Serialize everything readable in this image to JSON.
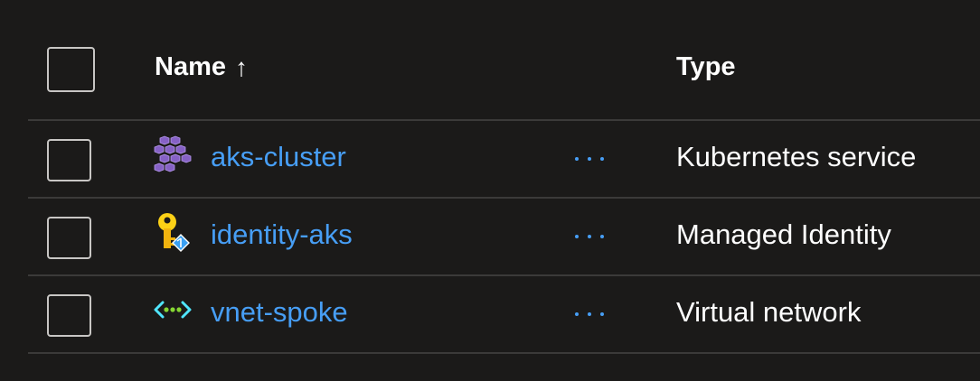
{
  "header": {
    "name_label": "Name",
    "sort_indicator": "↑",
    "type_label": "Type"
  },
  "rows": [
    {
      "name": "aks-cluster",
      "type": "Kubernetes service",
      "icon": "kubernetes-icon"
    },
    {
      "name": "identity-aks",
      "type": "Managed Identity",
      "icon": "managed-identity-icon"
    },
    {
      "name": "vnet-spoke",
      "type": "Virtual network",
      "icon": "virtual-network-icon"
    }
  ],
  "colors": {
    "background": "#1b1a19",
    "link": "#479ef5",
    "divider": "#3b3a39",
    "checkbox_border": "#c8c6c4"
  }
}
